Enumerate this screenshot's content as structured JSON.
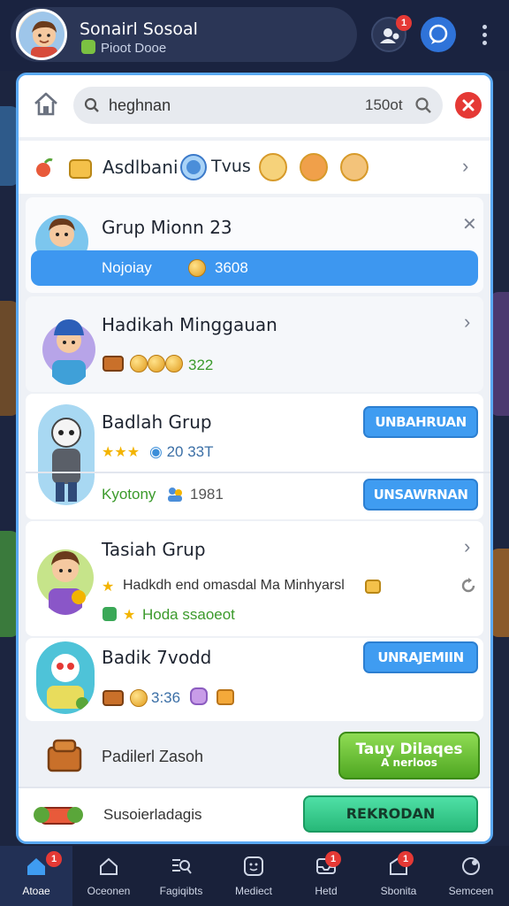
{
  "header": {
    "name": "Sonairl Sosoal",
    "subtitle": "Pioot Dooe",
    "notification_badge": "1"
  },
  "search": {
    "value": "heghnan",
    "count": "150ot"
  },
  "category_row": {
    "label": "Asdlbani",
    "tag": "Tvus"
  },
  "group1": {
    "title": "Grup Mionn 23",
    "bar_label": "Nojoiay",
    "bar_value": "3608"
  },
  "group2": {
    "title": "Hadikah Minggauan",
    "value": "322"
  },
  "group3": {
    "title": "Badlah Grup",
    "rating_value": "20 33T",
    "button1": "UNBAHRUAN",
    "status": "Kyotony",
    "count": "1981",
    "button2": "UNSAWRNAN"
  },
  "group4": {
    "title": "Tasiah Grup",
    "desc": "Hadkdh end omasdal Ma Minhyarsl",
    "tag": "Hoda ssaoeot"
  },
  "group5": {
    "title": "Badik 7vodd",
    "value": "3:36",
    "button": "UNRAJEMIIN"
  },
  "bottom1": {
    "label": "Padilerl Zasoh",
    "button_line1": "Tauy Dilaqes",
    "button_line2": "A nerloos"
  },
  "bottom2": {
    "label": "Susoierladagis",
    "button": "REKRODAN"
  },
  "nav": {
    "items": [
      {
        "label": "Atoae",
        "badge": "1"
      },
      {
        "label": "Oceonen",
        "badge": ""
      },
      {
        "label": "Fagiqibts",
        "badge": ""
      },
      {
        "label": "Mediect",
        "badge": ""
      },
      {
        "label": "Hetd",
        "badge": "1"
      },
      {
        "label": "Sbonita",
        "badge": "1"
      },
      {
        "label": "Semceen",
        "badge": ""
      }
    ]
  },
  "colors": {
    "accent": "#3f9cf1",
    "bar_blue": "#3d97f0",
    "green_button": "#5bb82a",
    "teal_button": "#2fc686",
    "close_red": "#e53935"
  }
}
